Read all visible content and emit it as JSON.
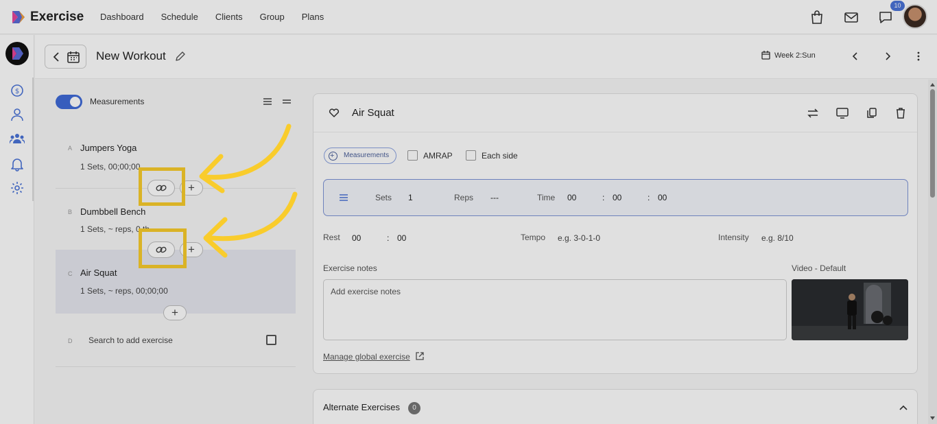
{
  "app": {
    "brand": "Exercise",
    "nav": [
      "Dashboard",
      "Schedule",
      "Clients",
      "Group",
      "Plans"
    ],
    "notification_count": "10"
  },
  "header": {
    "title": "New Workout",
    "week_label": "Week 2:Sun"
  },
  "left_panel": {
    "measurements_label": "Measurements",
    "exercises": [
      {
        "letter": "A",
        "name": "Jumpers Yoga",
        "summary": "1 Sets, 00;00;00"
      },
      {
        "letter": "B",
        "name": "Dumbbell Bench",
        "summary": "1 Sets, ~ reps, 0 th"
      },
      {
        "letter": "C",
        "name": "Air Squat",
        "summary": "1 Sets, ~ reps, 00;00;00"
      }
    ],
    "search_row": {
      "letter": "D",
      "placeholder": "Search to add exercise"
    }
  },
  "detail": {
    "title": "Air Squat",
    "measurements_pill": "Measurements",
    "amrap_label": "AMRAP",
    "each_side_label": "Each side",
    "sets_label": "Sets",
    "sets_value": "1",
    "reps_label": "Reps",
    "reps_value": "---",
    "time_label": "Time",
    "time_h": "00",
    "time_m": "00",
    "time_s": "00",
    "rest_label": "Rest",
    "rest_m": "00",
    "rest_s": "00",
    "tempo_label": "Tempo",
    "tempo_placeholder": "e.g. 3-0-1-0",
    "intensity_label": "Intensity",
    "intensity_placeholder": "e.g. 8/10",
    "notes_label": "Exercise notes",
    "notes_placeholder": "Add exercise notes",
    "video_label": "Video - Default",
    "manage_link": "Manage global exercise"
  },
  "alternate": {
    "title": "Alternate Exercises",
    "count": "0"
  },
  "colors": {
    "accent": "#3f6ad8",
    "highlight": "#f9cc2c"
  }
}
